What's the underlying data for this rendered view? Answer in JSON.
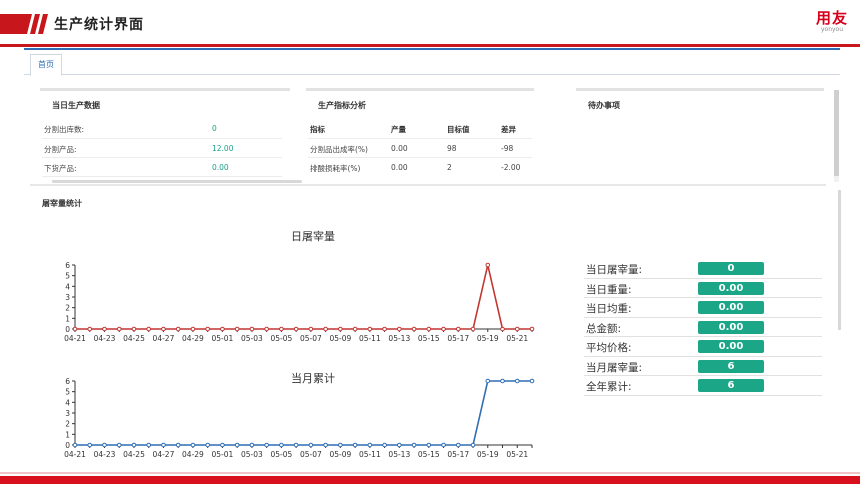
{
  "header": {
    "title": "生产统计界面"
  },
  "brand": {
    "name": "用友",
    "sub": "yonyou"
  },
  "tabs": [
    {
      "label": "首页"
    }
  ],
  "panel_production": {
    "title": "当日生产数据",
    "rows": [
      {
        "label": "分割出库数:",
        "value": "0"
      },
      {
        "label": "分割产品:",
        "value": "12.00"
      },
      {
        "label": "下货产品:",
        "value": "0.00"
      }
    ]
  },
  "panel_indicators": {
    "title": "生产指标分析",
    "headers": [
      "指标",
      "产量",
      "目标值",
      "差异"
    ],
    "rows": [
      [
        "分割品出成率(%)",
        "0.00",
        "98",
        "-98"
      ],
      [
        "排酸损耗率(%)",
        "0.00",
        "2",
        "-2.00"
      ]
    ]
  },
  "panel_todo": {
    "title": "待办事项"
  },
  "section": {
    "title": "屠宰量统计"
  },
  "stats": [
    {
      "label": "当日屠宰量:",
      "value": "0"
    },
    {
      "label": "当日重量:",
      "value": "0.00"
    },
    {
      "label": "当日均重:",
      "value": "0.00"
    },
    {
      "label": "总金额:",
      "value": "0.00"
    },
    {
      "label": "平均价格:",
      "value": "0.00"
    },
    {
      "label": "当月屠宰量:",
      "value": "6"
    },
    {
      "label": "全年累计:",
      "value": "6"
    }
  ],
  "colors": {
    "accent_red": "#c8161d",
    "teal": "#1aa687",
    "daily_line": "#c23531",
    "monthly_line": "#2f6db5"
  },
  "chart_data": [
    {
      "type": "line",
      "title": "日屠宰量",
      "x": [
        "04-21",
        "04-22",
        "04-23",
        "04-24",
        "04-25",
        "04-26",
        "04-27",
        "04-28",
        "04-29",
        "04-30",
        "05-01",
        "05-02",
        "05-03",
        "05-04",
        "05-05",
        "05-06",
        "05-07",
        "05-08",
        "05-09",
        "05-10",
        "05-11",
        "05-12",
        "05-13",
        "05-14",
        "05-15",
        "05-16",
        "05-17",
        "05-18",
        "05-19",
        "05-20",
        "05-21",
        "05-22"
      ],
      "tick_labels": [
        "04-21",
        "04-23",
        "04-25",
        "04-27",
        "04-29",
        "05-01",
        "05-03",
        "05-05",
        "05-07",
        "05-09",
        "05-11",
        "05-13",
        "05-15",
        "05-17",
        "05-19",
        "05-21"
      ],
      "series": [
        {
          "values": [
            0,
            0,
            0,
            0,
            0,
            0,
            0,
            0,
            0,
            0,
            0,
            0,
            0,
            0,
            0,
            0,
            0,
            0,
            0,
            0,
            0,
            0,
            0,
            0,
            0,
            0,
            0,
            0,
            6,
            0,
            0,
            0
          ]
        }
      ],
      "ylim": [
        0,
        6
      ],
      "yticks": [
        "0",
        "1",
        "2",
        "3",
        "4",
        "5",
        "6"
      ]
    },
    {
      "type": "line",
      "title": "当月累计",
      "x": [
        "04-21",
        "04-22",
        "04-23",
        "04-24",
        "04-25",
        "04-26",
        "04-27",
        "04-28",
        "04-29",
        "04-30",
        "05-01",
        "05-02",
        "05-03",
        "05-04",
        "05-05",
        "05-06",
        "05-07",
        "05-08",
        "05-09",
        "05-10",
        "05-11",
        "05-12",
        "05-13",
        "05-14",
        "05-15",
        "05-16",
        "05-17",
        "05-18",
        "05-19",
        "05-20",
        "05-21",
        "05-22"
      ],
      "tick_labels": [
        "04-21",
        "04-23",
        "04-25",
        "04-27",
        "04-29",
        "05-01",
        "05-03",
        "05-05",
        "05-07",
        "05-09",
        "05-11",
        "05-13",
        "05-15",
        "05-17",
        "05-19",
        "05-21"
      ],
      "series": [
        {
          "values": [
            0,
            0,
            0,
            0,
            0,
            0,
            0,
            0,
            0,
            0,
            0,
            0,
            0,
            0,
            0,
            0,
            0,
            0,
            0,
            0,
            0,
            0,
            0,
            0,
            0,
            0,
            0,
            0,
            6,
            6,
            6,
            6
          ]
        }
      ],
      "ylim": [
        0,
        6
      ],
      "yticks": [
        "0",
        "1",
        "2",
        "3",
        "4",
        "5",
        "6"
      ]
    }
  ]
}
